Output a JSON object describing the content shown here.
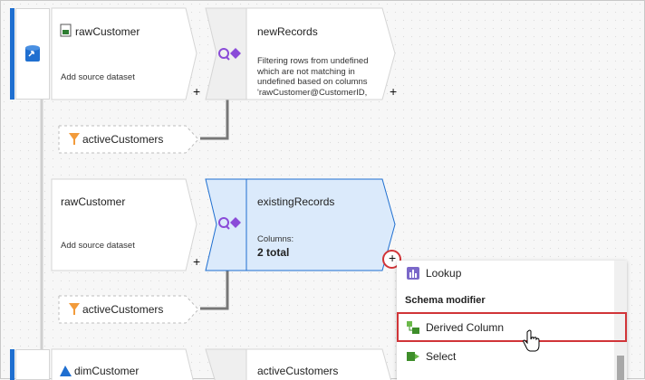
{
  "rows": [
    {
      "source_title": "rawCustomer",
      "source_sub": "Add source dataset",
      "transform_title": "newRecords",
      "transform_desc": "Filtering rows from undefined which are not matching in undefined based on columns 'rawCustomer@CustomerID, ...",
      "filter_label": "activeCustomers"
    },
    {
      "source_title": "rawCustomer",
      "source_sub": "Add source dataset",
      "transform_title": "existingRecords",
      "columns_label": "Columns:",
      "columns_value": "2 total",
      "filter_label": "activeCustomers"
    },
    {
      "source_title": "dimCustomer",
      "transform_title": "activeCustomers"
    }
  ],
  "plus_symbol": "+",
  "menu": {
    "lookup_label": "Lookup",
    "schema_header": "Schema modifier",
    "derived_label": "Derived Column",
    "select_label": "Select"
  },
  "colors": {
    "accent_blue": "#1a73e8",
    "highlight_red": "#d13438",
    "selected_fill": "#dbeafb",
    "join_purple": "#8a4bd8"
  }
}
